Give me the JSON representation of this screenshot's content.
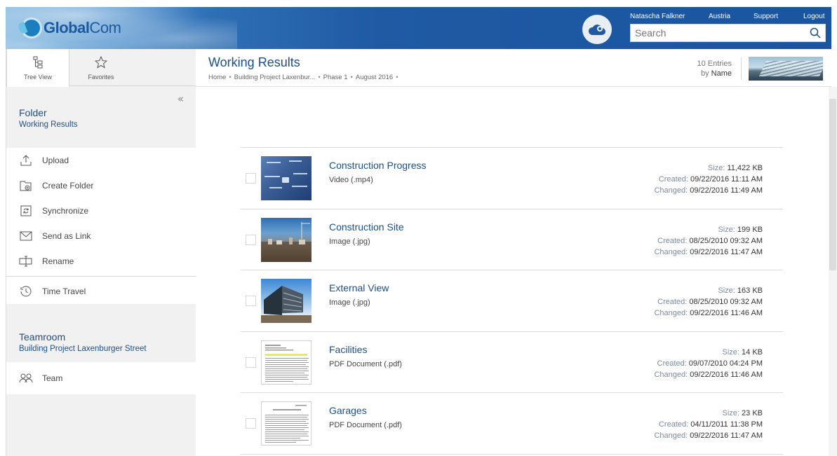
{
  "header": {
    "logo_text_a": "Global",
    "logo_text_b": "Com",
    "user_name": "Natascha Falkner",
    "region": "Austria",
    "support": "Support",
    "logout": "Logout",
    "search_placeholder": "Search"
  },
  "sidebar": {
    "tabs": [
      {
        "label": "Tree View",
        "icon": "tree-view-icon"
      },
      {
        "label": "Favorites",
        "icon": "star-icon"
      }
    ],
    "collapse_glyph": "«",
    "folder": {
      "title": "Folder",
      "name": "Working Results"
    },
    "actions": [
      {
        "label": "Upload",
        "icon": "upload-icon"
      },
      {
        "label": "Create Folder",
        "icon": "create-folder-icon"
      },
      {
        "label": "Synchronize",
        "icon": "sync-icon"
      },
      {
        "label": "Send as Link",
        "icon": "envelope-icon"
      },
      {
        "label": "Rename",
        "icon": "rename-icon"
      }
    ],
    "time_travel": {
      "label": "Time Travel",
      "icon": "clock-icon"
    },
    "teamroom": {
      "title": "Teamroom",
      "name": "Building Project Laxenburger Street"
    },
    "team": {
      "label": "Team",
      "icon": "people-icon"
    }
  },
  "main": {
    "title": "Working Results",
    "breadcrumb": [
      "Home",
      "Building Project Laxenbur...",
      "Phase 1",
      "August 2016"
    ],
    "entries_count": "10 Entries",
    "sort_prefix": "by",
    "sort_field": "Name"
  },
  "labels": {
    "size": "Size:",
    "created": "Created:",
    "changed": "Changed:"
  },
  "files": [
    {
      "name": "Construction Progress",
      "type": "Video (.mp4)",
      "size": "11,422 KB",
      "created": "09/22/2016 11:11 AM",
      "changed": "09/22/2016 11:49 AM"
    },
    {
      "name": "Construction Site",
      "type": "Image (.jpg)",
      "size": "199 KB",
      "created": "08/25/2010 09:32 AM",
      "changed": "09/22/2016 11:47 AM"
    },
    {
      "name": "External View",
      "type": "Image (.jpg)",
      "size": "163 KB",
      "created": "08/25/2010 09:32 AM",
      "changed": "09/22/2016 11:46 AM"
    },
    {
      "name": "Facilities",
      "type": "PDF Document (.pdf)",
      "size": "14 KB",
      "created": "09/07/2010 04:24 PM",
      "changed": "09/22/2016 11:46 AM"
    },
    {
      "name": "Garages",
      "type": "PDF Document (.pdf)",
      "size": "23 KB",
      "created": "04/11/2011 11:38 PM",
      "changed": "09/22/2016 11:47 AM"
    }
  ],
  "colors": {
    "header_blue": "#1a55a0",
    "link_blue": "#1c4f86",
    "sidebar_bg": "#f1f1f1"
  }
}
